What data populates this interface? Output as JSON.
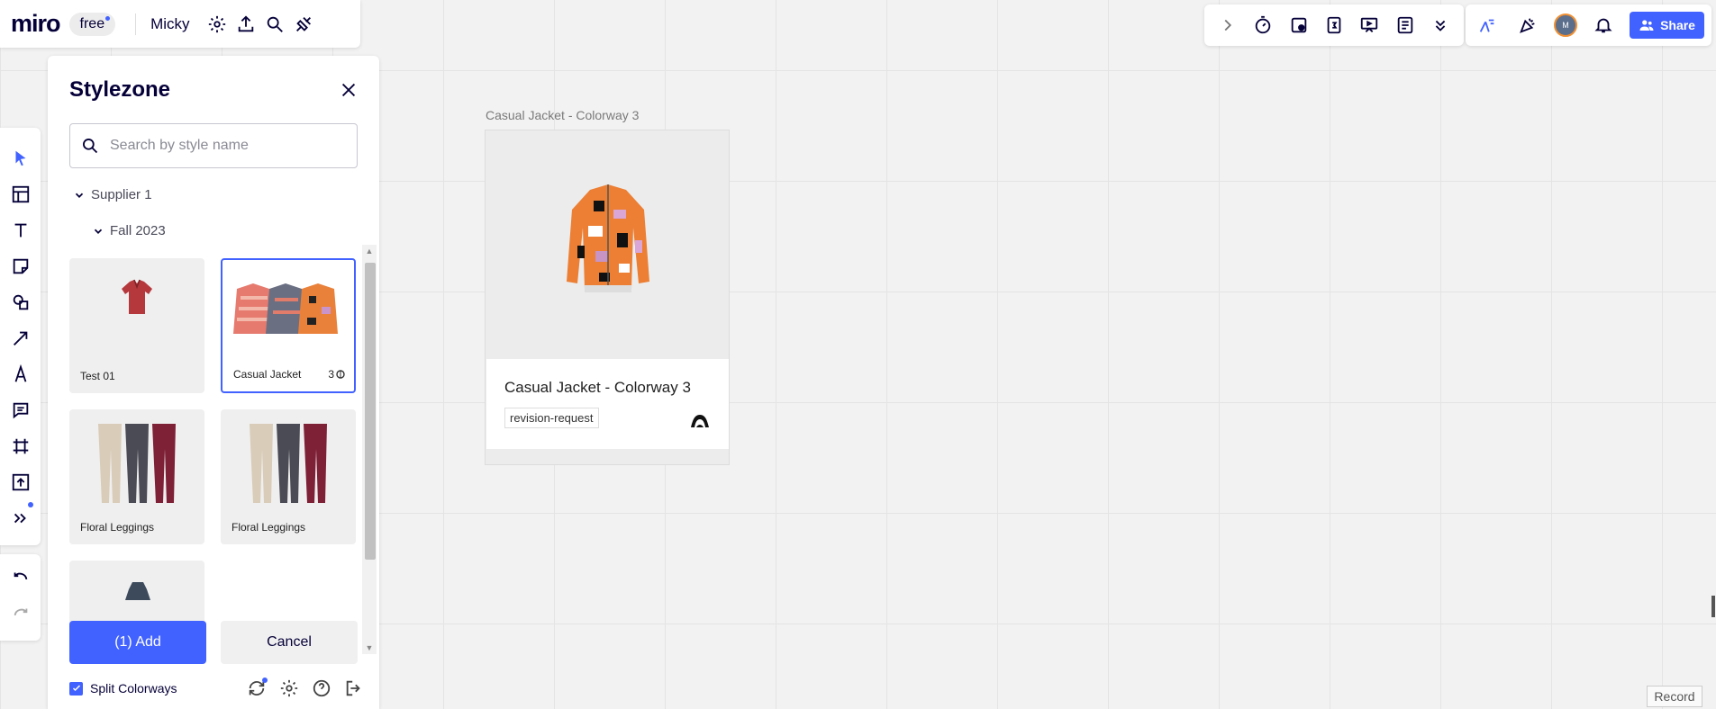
{
  "app": {
    "logo": "miro",
    "plan": "free",
    "board_name": "Micky"
  },
  "topbar_tools": [
    "chevron-right-icon",
    "timer-icon",
    "sticky-vote-icon",
    "calendar-icon",
    "present-icon",
    "notes-icon",
    "chevrons-down-icon"
  ],
  "collab": {
    "avatar_initial": "M",
    "share_label": "Share"
  },
  "stylezone": {
    "title": "Stylezone",
    "search_placeholder": "Search by style name",
    "tree": {
      "supplier": "Supplier 1",
      "season": "Fall 2023"
    },
    "cards": [
      {
        "label": "Test 01",
        "count": "",
        "selected": false
      },
      {
        "label": "Casual Jacket",
        "count": "3",
        "selected": true
      },
      {
        "label": "Floral Leggings",
        "count": "",
        "selected": false
      },
      {
        "label": "Floral Leggings",
        "count": "",
        "selected": false
      }
    ],
    "add_label": "(1) Add",
    "cancel_label": "Cancel",
    "split_colorways_label": "Split Colorways",
    "split_colorways_checked": true
  },
  "canvas": {
    "frame_title": "Casual Jacket - Colorway 3",
    "card_name": "Casual Jacket - Colorway 3",
    "tag": "revision-request"
  },
  "record_label": "Record",
  "colors": {
    "accent": "#4262ff",
    "text": "#050038"
  }
}
